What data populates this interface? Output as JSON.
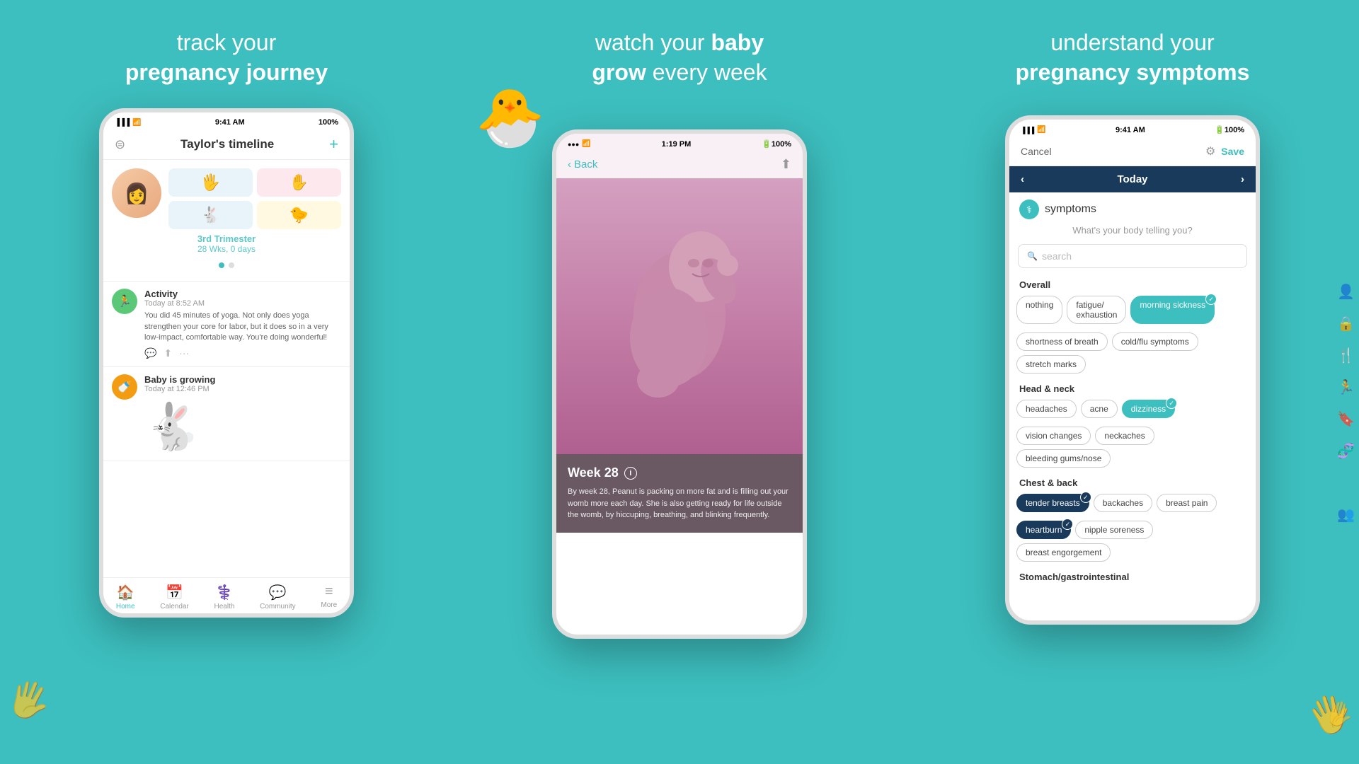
{
  "panels": {
    "left": {
      "heading_normal": "track your",
      "heading_bold": "pregnancy journey"
    },
    "middle": {
      "heading_normal": "watch your ",
      "heading_bold_inline": "baby grow",
      "heading_normal2": " every week"
    },
    "right": {
      "heading_normal": "understand your",
      "heading_bold": "pregnancy symptoms"
    }
  },
  "phone_left": {
    "status_time": "9:41 AM",
    "status_battery": "100%",
    "header_title": "Taylor's timeline",
    "trimester": "3rd Trimester",
    "weeks": "28 Wks, 0 days",
    "activity_title": "Activity",
    "activity_time": "Today at 8:52 AM",
    "activity_text": "You did 45 minutes of yoga. Not only does yoga strengthen your core for labor, but it does so in a very low-impact, comfortable way. You're doing wonderful!",
    "baby_growing_title": "Baby is growing",
    "baby_growing_time": "Today at 12:46 PM",
    "nav_home": "Home",
    "nav_calendar": "Calendar",
    "nav_health": "Health",
    "nav_community": "Community",
    "nav_more": "More"
  },
  "phone_middle": {
    "status_time": "1:19 PM",
    "status_battery": "100%",
    "back_label": "Back",
    "week_label": "Week 28",
    "week_desc": "By week 28, Peanut is packing on more fat and is filling out your womb more each day. She is also getting ready for life outside the womb, by hiccuping, breathing, and blinking frequently."
  },
  "phone_right": {
    "status_time": "9:41 AM",
    "status_battery": "100%",
    "cancel_label": "Cancel",
    "save_label": "Save",
    "nav_today": "Today",
    "symptoms_label": "symptoms",
    "body_prompt": "What's your body telling you?",
    "search_placeholder": "search",
    "section_overall": "Overall",
    "section_head_neck": "Head & neck",
    "section_chest_back": "Chest & back",
    "section_stomach": "Stomach/gastrointestinal",
    "chips_overall": [
      {
        "label": "nothing",
        "selected": false
      },
      {
        "label": "fatigue/ exhaustion",
        "selected": false
      },
      {
        "label": "morning sickness",
        "selected": true
      }
    ],
    "chips_overall2": [
      {
        "label": "shortness of breath",
        "selected": false
      },
      {
        "label": "cold/flu symptoms",
        "selected": false
      },
      {
        "label": "stretch marks",
        "selected": false
      }
    ],
    "chips_head": [
      {
        "label": "headaches",
        "selected": false
      },
      {
        "label": "acne",
        "selected": false
      },
      {
        "label": "dizziness",
        "selected": true
      }
    ],
    "chips_head2": [
      {
        "label": "vision changes",
        "selected": false
      },
      {
        "label": "neckaches",
        "selected": false
      },
      {
        "label": "bleeding gums/nose",
        "selected": false
      }
    ],
    "chips_chest": [
      {
        "label": "tender breasts",
        "selected": true,
        "dark": true
      },
      {
        "label": "backaches",
        "selected": false
      },
      {
        "label": "breast pain",
        "selected": false
      }
    ],
    "chips_chest2": [
      {
        "label": "heartburn",
        "selected": true,
        "dark": true
      },
      {
        "label": "nipple soreness",
        "selected": false
      },
      {
        "label": "breast engorgement",
        "selected": false
      }
    ]
  }
}
